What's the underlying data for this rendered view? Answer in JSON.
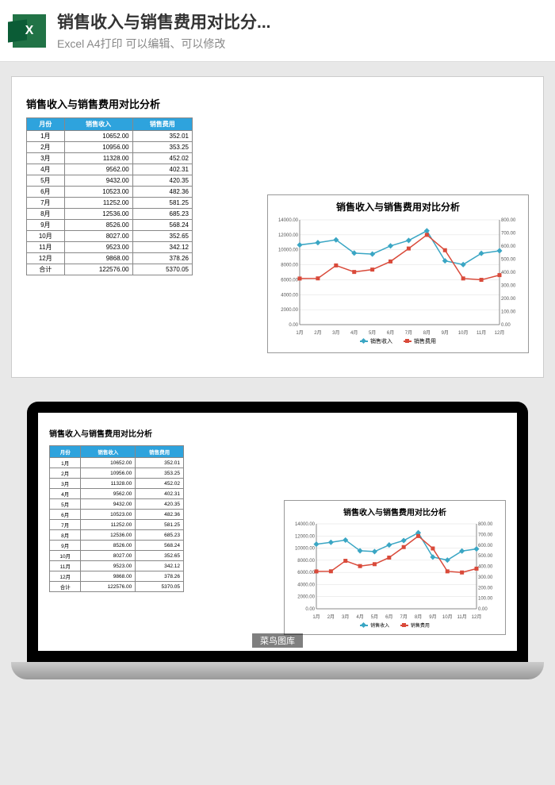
{
  "header": {
    "title": "销售收入与销售费用对比分...",
    "subtitle": "Excel A4打印 可以编辑、可以修改",
    "icon_letter": "X"
  },
  "doc_title": "销售收入与销售费用对比分析",
  "table": {
    "headers": [
      "月份",
      "销售收入",
      "销售费用"
    ],
    "rows": [
      [
        "1月",
        "10652.00",
        "352.01"
      ],
      [
        "2月",
        "10956.00",
        "353.25"
      ],
      [
        "3月",
        "11328.00",
        "452.02"
      ],
      [
        "4月",
        "9562.00",
        "402.31"
      ],
      [
        "5月",
        "9432.00",
        "420.35"
      ],
      [
        "6月",
        "10523.00",
        "482.36"
      ],
      [
        "7月",
        "11252.00",
        "581.25"
      ],
      [
        "8月",
        "12536.00",
        "685.23"
      ],
      [
        "9月",
        "8526.00",
        "568.24"
      ],
      [
        "10月",
        "8027.00",
        "352.65"
      ],
      [
        "11月",
        "9523.00",
        "342.12"
      ],
      [
        "12月",
        "9868.00",
        "378.26"
      ],
      [
        "合计",
        "122576.00",
        "5370.05"
      ]
    ]
  },
  "chart_data": {
    "type": "line",
    "title": "销售收入与销售费用对比分析",
    "categories": [
      "1月",
      "2月",
      "3月",
      "4月",
      "5月",
      "6月",
      "7月",
      "8月",
      "9月",
      "10月",
      "11月",
      "12月"
    ],
    "series": [
      {
        "name": "销售收入",
        "values": [
          10652,
          10956,
          11328,
          9562,
          9432,
          10523,
          11252,
          12536,
          8526,
          8027,
          9523,
          9868
        ],
        "axis": "left",
        "color": "#3aa6c4"
      },
      {
        "name": "销售费用",
        "values": [
          352.01,
          353.25,
          452.02,
          402.31,
          420.35,
          482.36,
          581.25,
          685.23,
          568.24,
          352.65,
          342.12,
          378.26
        ],
        "axis": "right",
        "color": "#d94a3a"
      }
    ],
    "ylim_left": [
      0,
      14000
    ],
    "yticks_left": [
      0,
      2000,
      4000,
      6000,
      8000,
      10000,
      12000,
      14000
    ],
    "ylim_right": [
      0,
      800
    ],
    "yticks_right": [
      0,
      100,
      200,
      300,
      400,
      500,
      600,
      700,
      800
    ],
    "legend": [
      "销售收入",
      "销售费用"
    ]
  },
  "watermark": "菜鸟图库"
}
